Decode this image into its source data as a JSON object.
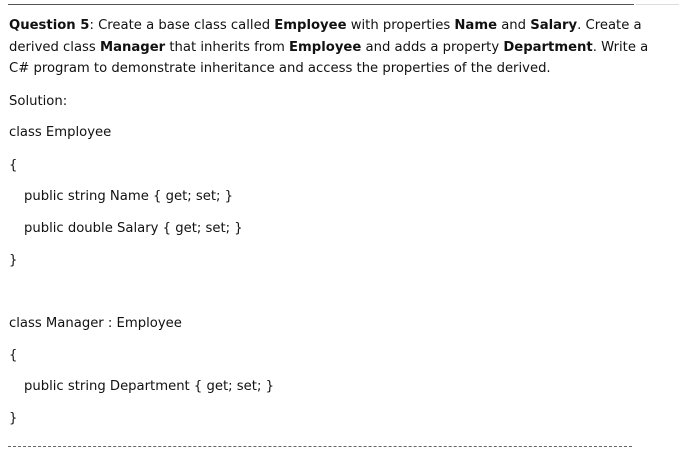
{
  "question": {
    "label": "Question 5",
    "colon": ":",
    "t1": " Create a base class called ",
    "b1": "Employee",
    "t2": " with properties ",
    "b2": "Name",
    "t3": " and ",
    "b3": "Salary",
    "t4": ". Create a derived class ",
    "b4": "Manager",
    "t5": " that inherits from ",
    "b5": "Employee",
    "t6": " and adds a property ",
    "b6": "Department",
    "t7": ". Write a C# program to demonstrate inheritance and access the properties of the derived."
  },
  "solution_label": "Solution:",
  "code": {
    "employee_decl": "class Employee",
    "employee_open": "{",
    "employee_name": "public string Name { get; set; }",
    "employee_salary": "public double Salary { get; set; }",
    "employee_close": "}",
    "manager_decl": "class Manager : Employee",
    "manager_open": "{",
    "manager_department": "public string Department { get; set; }",
    "manager_close": "}"
  }
}
